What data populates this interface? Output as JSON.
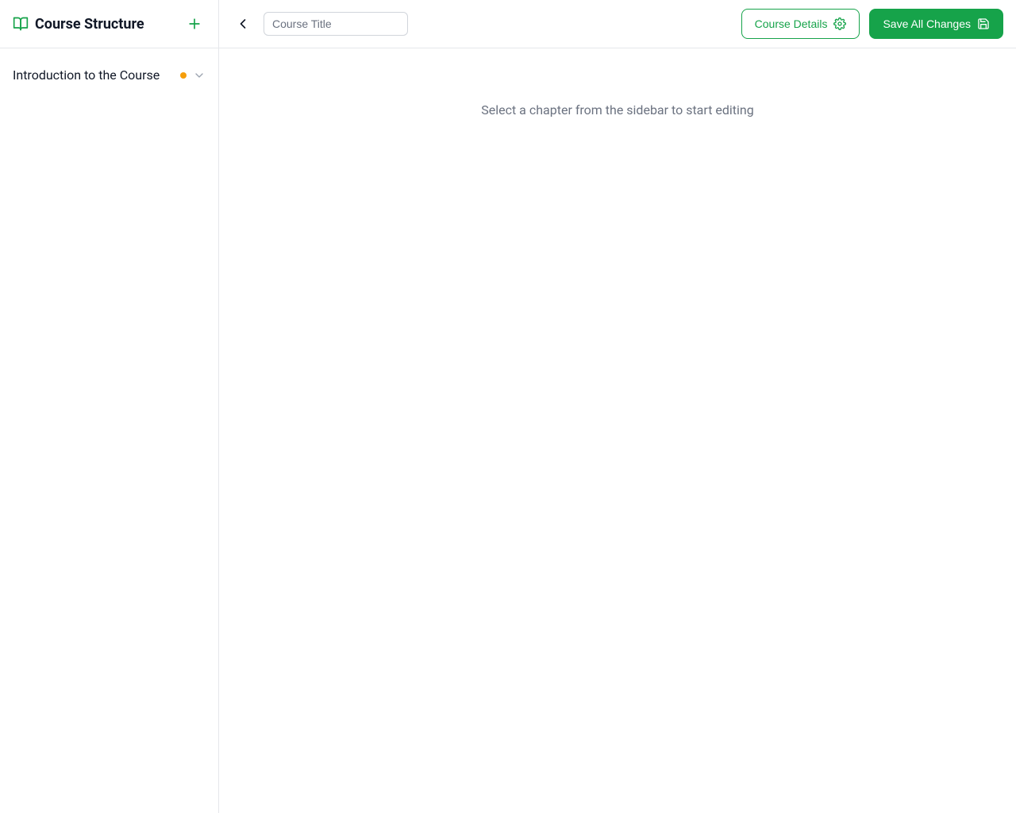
{
  "sidebar": {
    "title": "Course Structure",
    "items": [
      {
        "label": "Introduction to the Course",
        "status": "pending"
      }
    ]
  },
  "topbar": {
    "title_placeholder": "Course Title",
    "title_value": "",
    "course_details_label": "Course Details",
    "save_label": "Save All Changes"
  },
  "main": {
    "empty_message": "Select a chapter from the sidebar to start editing"
  },
  "colors": {
    "accent": "#16a34a",
    "status_pending": "#f59e0b",
    "muted_text": "#6b7280"
  }
}
